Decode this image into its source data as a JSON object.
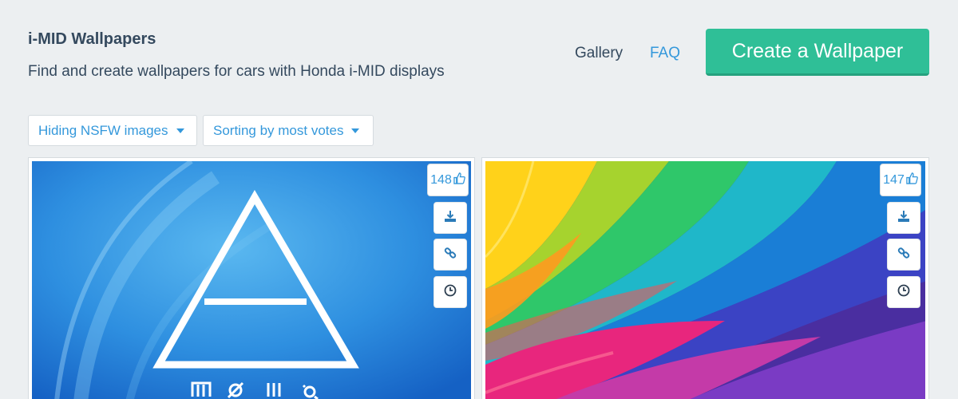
{
  "header": {
    "title": "i-MID Wallpapers",
    "subtitle": "Find and create wallpapers for cars with Honda i-MID displays"
  },
  "nav": {
    "gallery": "Gallery",
    "faq": "FAQ",
    "create_button": "Create a Wallpaper"
  },
  "filters": {
    "nsfw": "Hiding NSFW images",
    "sort": "Sorting by most votes"
  },
  "cards": [
    {
      "votes": "148"
    },
    {
      "votes": "147"
    }
  ],
  "icons": [
    "thumbs-up-icon",
    "download-icon",
    "link-icon",
    "clock-icon",
    "caret-down-icon"
  ],
  "colors": {
    "accent": "#2fbf97",
    "link": "#3498db",
    "text": "#34495e",
    "background": "#eceff1"
  }
}
